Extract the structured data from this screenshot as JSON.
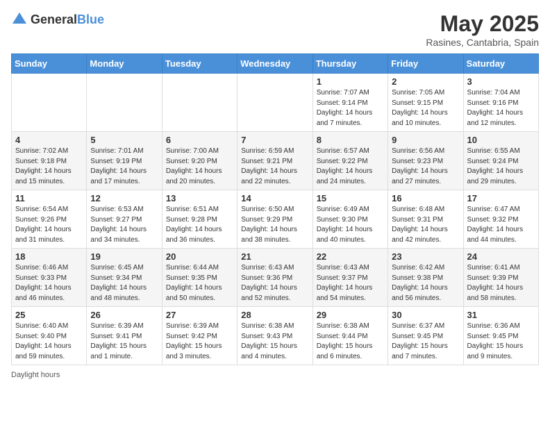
{
  "header": {
    "logo_general": "General",
    "logo_blue": "Blue",
    "month_title": "May 2025",
    "location": "Rasines, Cantabria, Spain"
  },
  "weekdays": [
    "Sunday",
    "Monday",
    "Tuesday",
    "Wednesday",
    "Thursday",
    "Friday",
    "Saturday"
  ],
  "footer": {
    "daylight_label": "Daylight hours"
  },
  "weeks": [
    [
      {
        "day": "",
        "info": ""
      },
      {
        "day": "",
        "info": ""
      },
      {
        "day": "",
        "info": ""
      },
      {
        "day": "",
        "info": ""
      },
      {
        "day": "1",
        "info": "Sunrise: 7:07 AM\nSunset: 9:14 PM\nDaylight: 14 hours\nand 7 minutes."
      },
      {
        "day": "2",
        "info": "Sunrise: 7:05 AM\nSunset: 9:15 PM\nDaylight: 14 hours\nand 10 minutes."
      },
      {
        "day": "3",
        "info": "Sunrise: 7:04 AM\nSunset: 9:16 PM\nDaylight: 14 hours\nand 12 minutes."
      }
    ],
    [
      {
        "day": "4",
        "info": "Sunrise: 7:02 AM\nSunset: 9:18 PM\nDaylight: 14 hours\nand 15 minutes."
      },
      {
        "day": "5",
        "info": "Sunrise: 7:01 AM\nSunset: 9:19 PM\nDaylight: 14 hours\nand 17 minutes."
      },
      {
        "day": "6",
        "info": "Sunrise: 7:00 AM\nSunset: 9:20 PM\nDaylight: 14 hours\nand 20 minutes."
      },
      {
        "day": "7",
        "info": "Sunrise: 6:59 AM\nSunset: 9:21 PM\nDaylight: 14 hours\nand 22 minutes."
      },
      {
        "day": "8",
        "info": "Sunrise: 6:57 AM\nSunset: 9:22 PM\nDaylight: 14 hours\nand 24 minutes."
      },
      {
        "day": "9",
        "info": "Sunrise: 6:56 AM\nSunset: 9:23 PM\nDaylight: 14 hours\nand 27 minutes."
      },
      {
        "day": "10",
        "info": "Sunrise: 6:55 AM\nSunset: 9:24 PM\nDaylight: 14 hours\nand 29 minutes."
      }
    ],
    [
      {
        "day": "11",
        "info": "Sunrise: 6:54 AM\nSunset: 9:26 PM\nDaylight: 14 hours\nand 31 minutes."
      },
      {
        "day": "12",
        "info": "Sunrise: 6:53 AM\nSunset: 9:27 PM\nDaylight: 14 hours\nand 34 minutes."
      },
      {
        "day": "13",
        "info": "Sunrise: 6:51 AM\nSunset: 9:28 PM\nDaylight: 14 hours\nand 36 minutes."
      },
      {
        "day": "14",
        "info": "Sunrise: 6:50 AM\nSunset: 9:29 PM\nDaylight: 14 hours\nand 38 minutes."
      },
      {
        "day": "15",
        "info": "Sunrise: 6:49 AM\nSunset: 9:30 PM\nDaylight: 14 hours\nand 40 minutes."
      },
      {
        "day": "16",
        "info": "Sunrise: 6:48 AM\nSunset: 9:31 PM\nDaylight: 14 hours\nand 42 minutes."
      },
      {
        "day": "17",
        "info": "Sunrise: 6:47 AM\nSunset: 9:32 PM\nDaylight: 14 hours\nand 44 minutes."
      }
    ],
    [
      {
        "day": "18",
        "info": "Sunrise: 6:46 AM\nSunset: 9:33 PM\nDaylight: 14 hours\nand 46 minutes."
      },
      {
        "day": "19",
        "info": "Sunrise: 6:45 AM\nSunset: 9:34 PM\nDaylight: 14 hours\nand 48 minutes."
      },
      {
        "day": "20",
        "info": "Sunrise: 6:44 AM\nSunset: 9:35 PM\nDaylight: 14 hours\nand 50 minutes."
      },
      {
        "day": "21",
        "info": "Sunrise: 6:43 AM\nSunset: 9:36 PM\nDaylight: 14 hours\nand 52 minutes."
      },
      {
        "day": "22",
        "info": "Sunrise: 6:43 AM\nSunset: 9:37 PM\nDaylight: 14 hours\nand 54 minutes."
      },
      {
        "day": "23",
        "info": "Sunrise: 6:42 AM\nSunset: 9:38 PM\nDaylight: 14 hours\nand 56 minutes."
      },
      {
        "day": "24",
        "info": "Sunrise: 6:41 AM\nSunset: 9:39 PM\nDaylight: 14 hours\nand 58 minutes."
      }
    ],
    [
      {
        "day": "25",
        "info": "Sunrise: 6:40 AM\nSunset: 9:40 PM\nDaylight: 14 hours\nand 59 minutes."
      },
      {
        "day": "26",
        "info": "Sunrise: 6:39 AM\nSunset: 9:41 PM\nDaylight: 15 hours\nand 1 minute."
      },
      {
        "day": "27",
        "info": "Sunrise: 6:39 AM\nSunset: 9:42 PM\nDaylight: 15 hours\nand 3 minutes."
      },
      {
        "day": "28",
        "info": "Sunrise: 6:38 AM\nSunset: 9:43 PM\nDaylight: 15 hours\nand 4 minutes."
      },
      {
        "day": "29",
        "info": "Sunrise: 6:38 AM\nSunset: 9:44 PM\nDaylight: 15 hours\nand 6 minutes."
      },
      {
        "day": "30",
        "info": "Sunrise: 6:37 AM\nSunset: 9:45 PM\nDaylight: 15 hours\nand 7 minutes."
      },
      {
        "day": "31",
        "info": "Sunrise: 6:36 AM\nSunset: 9:45 PM\nDaylight: 15 hours\nand 9 minutes."
      }
    ]
  ]
}
